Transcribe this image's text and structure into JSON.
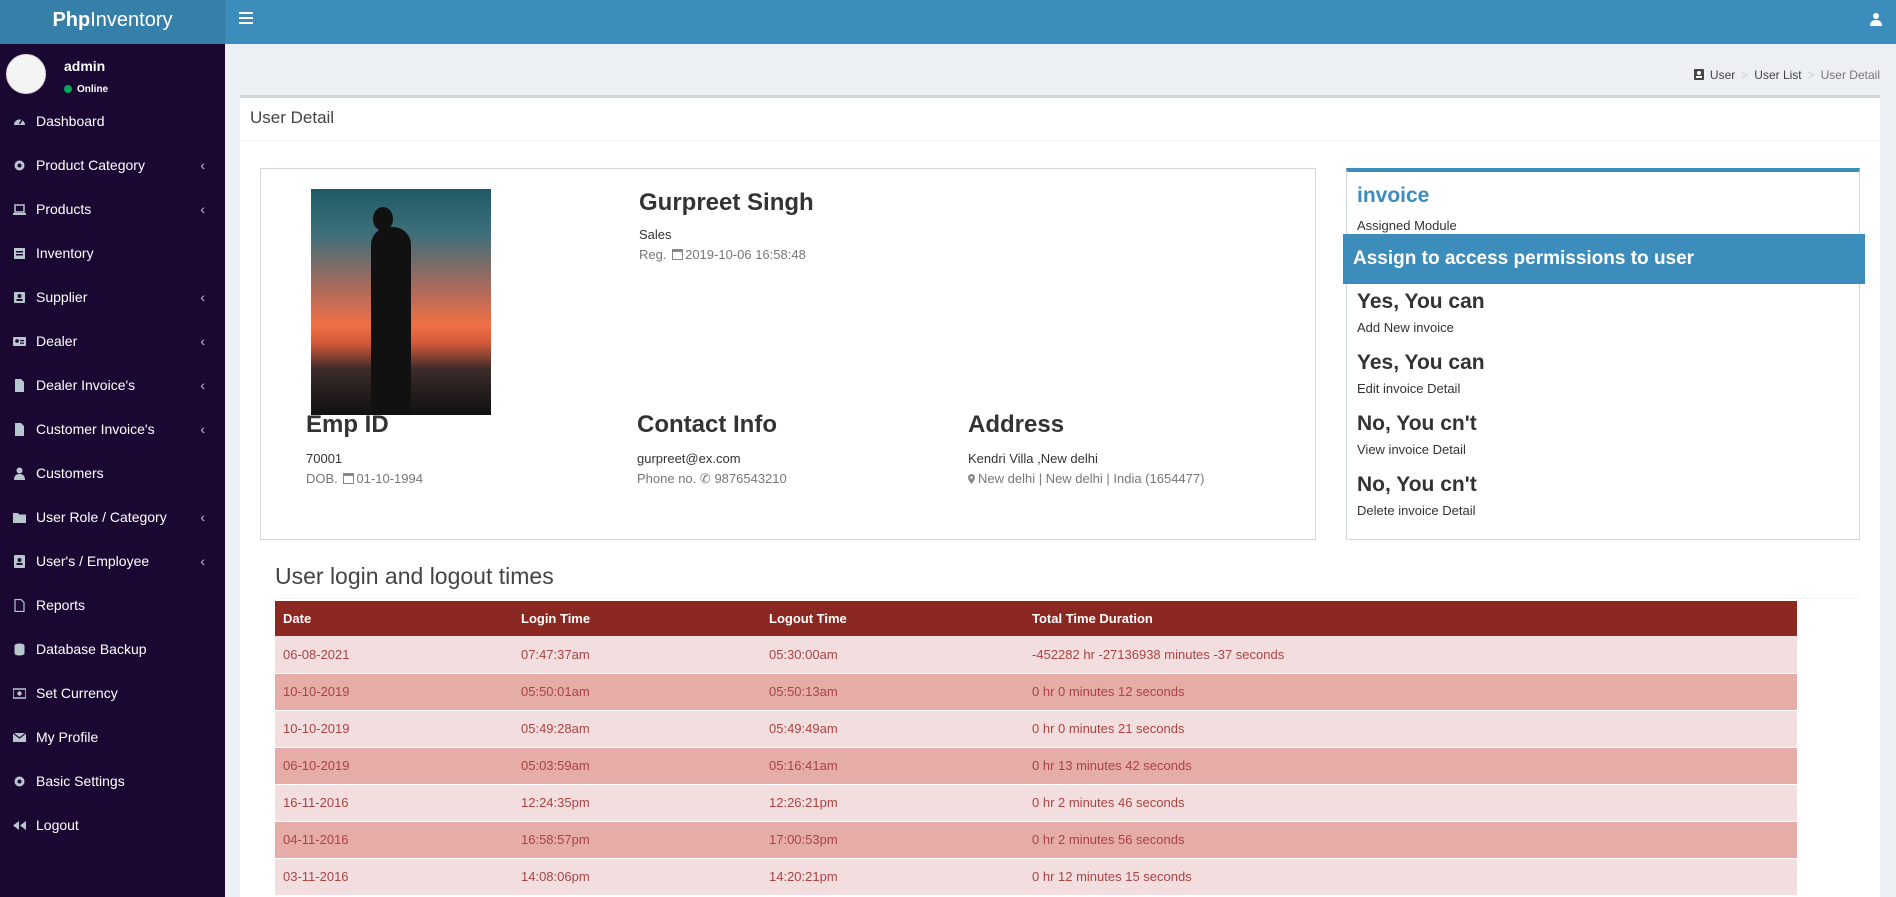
{
  "header": {
    "brand_bold": "Php",
    "brand_rest": "Inventory"
  },
  "sidebar": {
    "user": {
      "name": "admin",
      "status": "Online"
    },
    "items": [
      {
        "label": "Dashboard",
        "icon": "dashboard-icon",
        "has_children": false
      },
      {
        "label": "Product Category",
        "icon": "gear-icon",
        "has_children": true
      },
      {
        "label": "Products",
        "icon": "laptop-icon",
        "has_children": true
      },
      {
        "label": "Inventory",
        "icon": "inventory-icon",
        "has_children": false
      },
      {
        "label": "Supplier",
        "icon": "supplier-icon",
        "has_children": true
      },
      {
        "label": "Dealer",
        "icon": "id-card-icon",
        "has_children": true
      },
      {
        "label": "Dealer Invoice's",
        "icon": "file-icon",
        "has_children": true
      },
      {
        "label": "Customer Invoice's",
        "icon": "file-icon",
        "has_children": true
      },
      {
        "label": "Customers",
        "icon": "user-icon",
        "has_children": false
      },
      {
        "label": "User Role / Category",
        "icon": "folder-icon",
        "has_children": true
      },
      {
        "label": "User's / Employee",
        "icon": "address-book-icon",
        "has_children": true
      },
      {
        "label": "Reports",
        "icon": "file-outline-icon",
        "has_children": false
      },
      {
        "label": "Database Backup",
        "icon": "database-icon",
        "has_children": false
      },
      {
        "label": "Set Currency",
        "icon": "money-icon",
        "has_children": false
      },
      {
        "label": "My Profile",
        "icon": "envelope-icon",
        "has_children": false
      },
      {
        "label": "Basic Settings",
        "icon": "gear-icon",
        "has_children": false
      },
      {
        "label": "Logout",
        "icon": "backward-icon",
        "has_children": false
      }
    ]
  },
  "breadcrumb": {
    "items": [
      "User",
      "User List",
      "User Detail"
    ]
  },
  "page": {
    "title": "User Detail"
  },
  "profile": {
    "name": "Gurpreet Singh",
    "role": "Sales",
    "reg_label": "Reg.",
    "reg_date": "2019-10-06 16:58:48",
    "emp_id_heading": "Emp ID",
    "emp_id": "70001",
    "dob_label": "DOB.",
    "dob": "01-10-1994",
    "contact_heading": "Contact Info",
    "email": "gurpreet@ex.com",
    "phone_label": "Phone no.",
    "phone": "9876543210",
    "address_heading": "Address",
    "address_line": "Kendri Villa ,New delhi",
    "address_detail": "New delhi | New delhi | India (1654477)"
  },
  "permissions": {
    "module": "invoice",
    "module_sub": "Assigned Module",
    "banner": "Assign to access permissions to user",
    "items": [
      {
        "answer": "Yes, You can",
        "action": "Add New invoice"
      },
      {
        "answer": "Yes, You can",
        "action": "Edit invoice Detail"
      },
      {
        "answer": "No, You cn't",
        "action": "View invoice Detail"
      },
      {
        "answer": "No, You cn't",
        "action": "Delete invoice Detail"
      }
    ]
  },
  "log": {
    "title": "User login and logout times",
    "columns": [
      "Date",
      "Login Time",
      "Logout Time",
      "Total Time Duration"
    ],
    "rows": [
      [
        "06-08-2021",
        "07:47:37am",
        "05:30:00am",
        "-452282 hr -27136938 minutes -37 seconds"
      ],
      [
        "10-10-2019",
        "05:50:01am",
        "05:50:13am",
        "0 hr 0 minutes 12 seconds"
      ],
      [
        "10-10-2019",
        "05:49:28am",
        "05:49:49am",
        "0 hr 0 minutes 21 seconds"
      ],
      [
        "06-10-2019",
        "05:03:59am",
        "05:16:41am",
        "0 hr 13 minutes 42 seconds"
      ],
      [
        "16-11-2016",
        "12:24:35pm",
        "12:26:21pm",
        "0 hr 2 minutes 46 seconds"
      ],
      [
        "04-11-2016",
        "16:58:57pm",
        "17:00:53pm",
        "0 hr 2 minutes 56 seconds"
      ],
      [
        "03-11-2016",
        "14:08:06pm",
        "14:20:21pm",
        "0 hr 12 minutes 15 seconds"
      ]
    ]
  },
  "colors": {
    "sidebar_bg": "#1a0832",
    "header_bg": "#3c8dbc",
    "logo_bg": "#367fa9",
    "table_head_bg": "#8b2822",
    "row_odd_bg": "#f2dede",
    "row_even_bg": "#e6aca8",
    "row_text": "#a94442"
  }
}
